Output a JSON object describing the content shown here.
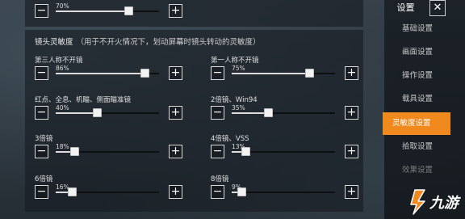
{
  "top_setting": {
    "percent": "70%",
    "value": 0.7
  },
  "panel": {
    "title": "镜头灵敏度",
    "note": "（用于不开火情况下，划动屏幕时镜头转动的灵敏度）"
  },
  "settings": [
    {
      "label": "第三人称不开镜",
      "percent": "86%",
      "value": 0.86
    },
    {
      "label": "第一人称不开镜",
      "percent": "75%",
      "value": 0.75
    },
    {
      "label": "红点、全息、机瞄、侧面瞄准镜",
      "percent": "40%",
      "value": 0.4
    },
    {
      "label": "2倍镜、Win94",
      "percent": "35%",
      "value": 0.35
    },
    {
      "label": "3倍镜",
      "percent": "18%",
      "value": 0.18
    },
    {
      "label": "4倍镜、VSS",
      "percent": "13%",
      "value": 0.13
    },
    {
      "label": "6倍镜",
      "percent": "16%",
      "value": 0.16
    },
    {
      "label": "8倍镜",
      "percent": "9%",
      "value": 0.09
    }
  ],
  "buttons": {
    "minus": "−",
    "plus": "+"
  },
  "nav": {
    "title": "设置",
    "close": "✕",
    "items": [
      {
        "label": "基础设置"
      },
      {
        "label": "画面设置"
      },
      {
        "label": "操作设置"
      },
      {
        "label": "载具设置"
      },
      {
        "label": "灵敏度设置"
      },
      {
        "label": "拾取设置"
      },
      {
        "label": "效果设置"
      }
    ],
    "active_index": 4
  },
  "watermark": {
    "text": "九游",
    "accent": "#f0891e"
  },
  "colors": {
    "accent": "#f0891e",
    "panel": "#161c22",
    "track": "#0d0f11",
    "fill": "#dddddd"
  }
}
